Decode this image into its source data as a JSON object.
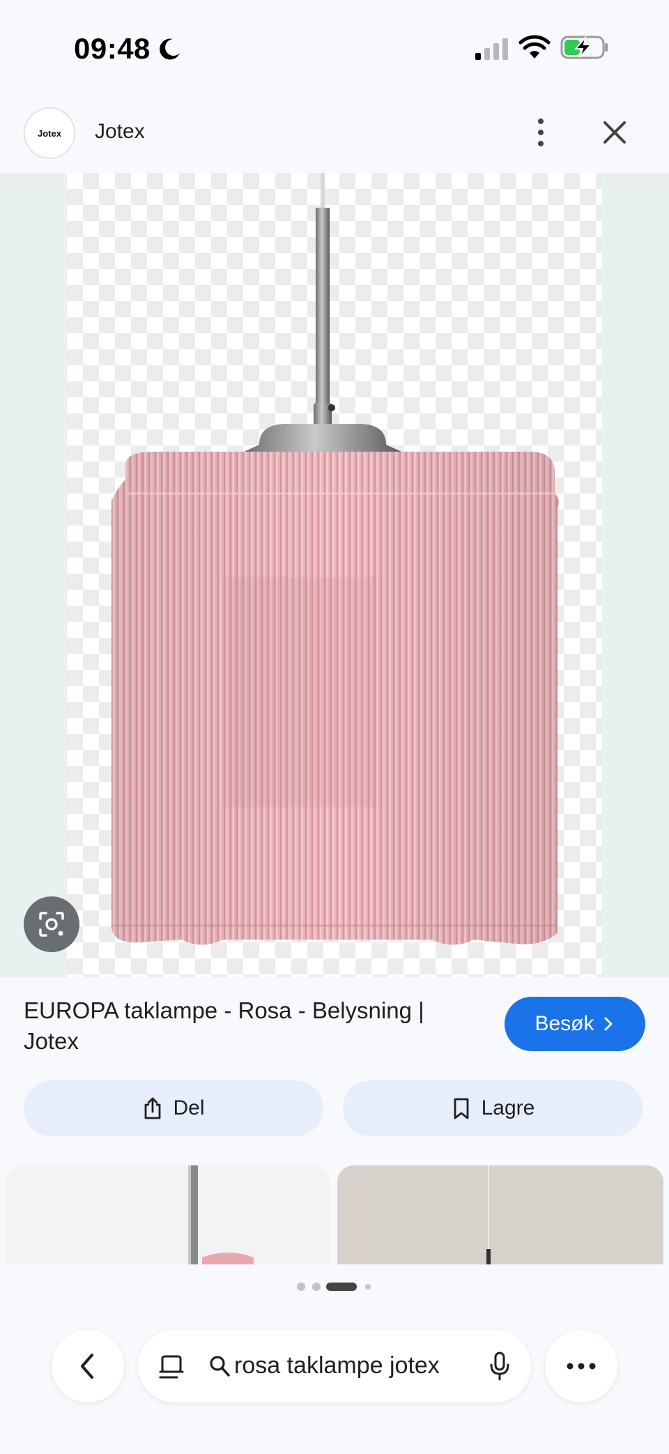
{
  "status_bar": {
    "time": "09:48",
    "icons": [
      "moon-icon",
      "signal-icon",
      "wifi-icon",
      "battery-charging-icon"
    ]
  },
  "header": {
    "logo_text": "Jotex",
    "site_name": "Jotex",
    "icons": [
      "more-vert-icon",
      "close-icon"
    ]
  },
  "preview": {
    "icons": [
      "lens-icon"
    ]
  },
  "result": {
    "title": "EUROPA taklampe - Rosa - Belysning | Jotex",
    "visit_label": "Besøk"
  },
  "actions": {
    "share_label": "Del",
    "save_label": "Lagre"
  },
  "pager": {
    "count": 4,
    "active_index": 2
  },
  "search": {
    "query": "rosa taklampe jotex"
  },
  "colors": {
    "accent": "#1a73e8",
    "action_bg": "#e6edfb",
    "lamp_pink": "#e8a8b0"
  }
}
